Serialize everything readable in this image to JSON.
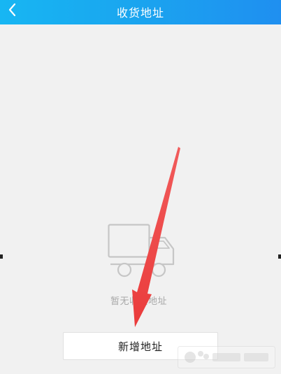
{
  "header": {
    "title": "收货地址",
    "back_icon": "chevron-left-icon"
  },
  "empty_state": {
    "icon": "truck-icon",
    "text": "暂无收货地址"
  },
  "actions": {
    "new_address_label": "新增地址"
  },
  "colors": {
    "header_start": "#17b6f3",
    "header_end": "#1f8ff0",
    "background": "#f1f1f1",
    "annotation_arrow": "#f24545"
  },
  "watermark": {
    "logo": "Baidu"
  }
}
